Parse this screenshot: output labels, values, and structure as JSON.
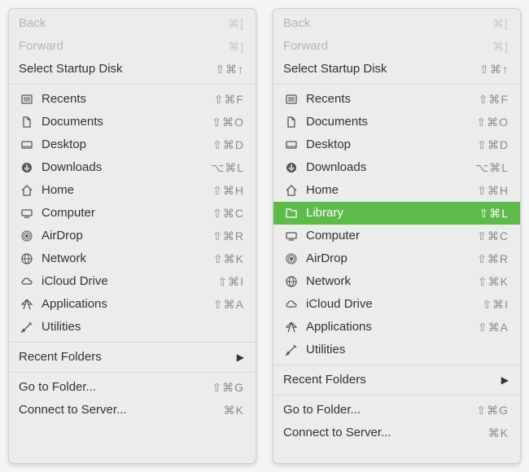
{
  "left": {
    "nav": [
      {
        "label": "Back",
        "shortcut": "⌘[",
        "disabled": true
      },
      {
        "label": "Forward",
        "shortcut": "⌘]",
        "disabled": true
      },
      {
        "label": "Select Startup Disk",
        "shortcut": "⇧⌘↑",
        "disabled": false
      }
    ],
    "locations": [
      {
        "icon": "recents",
        "label": "Recents",
        "shortcut": "⇧⌘F"
      },
      {
        "icon": "documents",
        "label": "Documents",
        "shortcut": "⇧⌘O"
      },
      {
        "icon": "desktop",
        "label": "Desktop",
        "shortcut": "⇧⌘D"
      },
      {
        "icon": "downloads",
        "label": "Downloads",
        "shortcut": "⌥⌘L"
      },
      {
        "icon": "home",
        "label": "Home",
        "shortcut": "⇧⌘H"
      },
      {
        "icon": "computer",
        "label": "Computer",
        "shortcut": "⇧⌘C"
      },
      {
        "icon": "airdrop",
        "label": "AirDrop",
        "shortcut": "⇧⌘R"
      },
      {
        "icon": "network",
        "label": "Network",
        "shortcut": "⇧⌘K"
      },
      {
        "icon": "icloud",
        "label": "iCloud Drive",
        "shortcut": "⇧⌘I"
      },
      {
        "icon": "applications",
        "label": "Applications",
        "shortcut": "⇧⌘A"
      },
      {
        "icon": "utilities",
        "label": "Utilities",
        "shortcut": ""
      }
    ],
    "recent": {
      "label": "Recent Folders"
    },
    "actions": [
      {
        "label": "Go to Folder...",
        "shortcut": "⇧⌘G"
      },
      {
        "label": "Connect to Server...",
        "shortcut": "⌘K"
      }
    ]
  },
  "right": {
    "nav": [
      {
        "label": "Back",
        "shortcut": "⌘[",
        "disabled": true
      },
      {
        "label": "Forward",
        "shortcut": "⌘]",
        "disabled": true
      },
      {
        "label": "Select Startup Disk",
        "shortcut": "⇧⌘↑",
        "disabled": false
      }
    ],
    "locations": [
      {
        "icon": "recents",
        "label": "Recents",
        "shortcut": "⇧⌘F"
      },
      {
        "icon": "documents",
        "label": "Documents",
        "shortcut": "⇧⌘O"
      },
      {
        "icon": "desktop",
        "label": "Desktop",
        "shortcut": "⇧⌘D"
      },
      {
        "icon": "downloads",
        "label": "Downloads",
        "shortcut": "⌥⌘L"
      },
      {
        "icon": "home",
        "label": "Home",
        "shortcut": "⇧⌘H"
      },
      {
        "icon": "library",
        "label": "Library",
        "shortcut": "⇧⌘L",
        "selected": true
      },
      {
        "icon": "computer",
        "label": "Computer",
        "shortcut": "⇧⌘C"
      },
      {
        "icon": "airdrop",
        "label": "AirDrop",
        "shortcut": "⇧⌘R"
      },
      {
        "icon": "network",
        "label": "Network",
        "shortcut": "⇧⌘K"
      },
      {
        "icon": "icloud",
        "label": "iCloud Drive",
        "shortcut": "⇧⌘I"
      },
      {
        "icon": "applications",
        "label": "Applications",
        "shortcut": "⇧⌘A"
      },
      {
        "icon": "utilities",
        "label": "Utilities",
        "shortcut": ""
      }
    ],
    "recent": {
      "label": "Recent Folders"
    },
    "actions": [
      {
        "label": "Go to Folder...",
        "shortcut": "⇧⌘G"
      },
      {
        "label": "Connect to Server...",
        "shortcut": "⌘K"
      }
    ]
  }
}
